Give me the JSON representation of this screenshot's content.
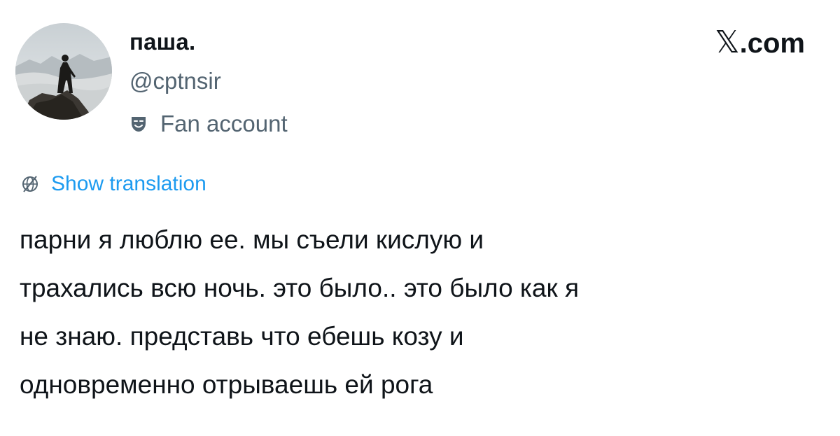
{
  "user": {
    "display_name": "паша.",
    "handle": "@cptnsir",
    "label_icon": "theater-mask-icon",
    "label_text": "Fan account",
    "avatar": "wanderer-above-sea-of-fog-painting"
  },
  "brand": {
    "x": "𝕏",
    "domain": ".com"
  },
  "translation": {
    "icon": "globe-icon",
    "label": "Show translation",
    "color": "#1d9bf0"
  },
  "tweet": {
    "lines": [
      "парни я люблю ее. мы съели кислую и",
      "трахались всю ночь. это было.. это было как я",
      "не знаю. представь что ебешь козу и",
      "одновременно отрываешь ей рога"
    ]
  },
  "colors": {
    "text": "#0f1419",
    "secondary": "#536471",
    "link": "#1d9bf0"
  }
}
